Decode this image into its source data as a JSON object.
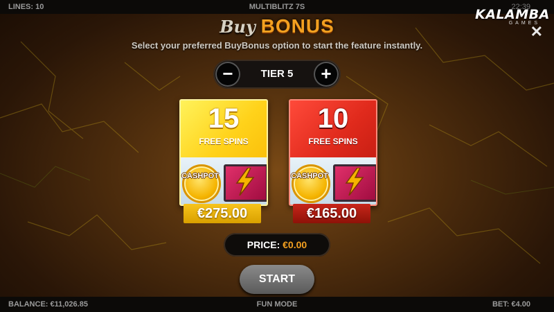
{
  "top_bar": {
    "lines": "LINES: 10",
    "game_title": "MULTIBLITZ 7S",
    "time": "22:39"
  },
  "logo": {
    "brand": "KALAMBA",
    "sub": "GAMES"
  },
  "header": {
    "buy": "Buy",
    "bonus": "BONUS",
    "subtitle": "Select your preferred BuyBonus option to start the feature instantly."
  },
  "tier": {
    "minus": "−",
    "label": "TIER 5",
    "plus": "+"
  },
  "options": [
    {
      "count": "15",
      "label": "FREE SPINS",
      "coin": "CASHPOT",
      "price": "€275.00",
      "color": "#ffd21a"
    },
    {
      "count": "10",
      "label": "FREE SPINS",
      "coin": "CASHPOT",
      "price": "€165.00",
      "color": "#e02a1c"
    }
  ],
  "price": {
    "label": "PRICE:",
    "value": "€0.00"
  },
  "start_label": "START",
  "bottom_bar": {
    "balance": "BALANCE: €11,026.85",
    "mode": "FUN MODE",
    "bet": "BET: €4.00"
  },
  "colors": {
    "accent": "#f3a020",
    "bolt": "#f5b400"
  }
}
